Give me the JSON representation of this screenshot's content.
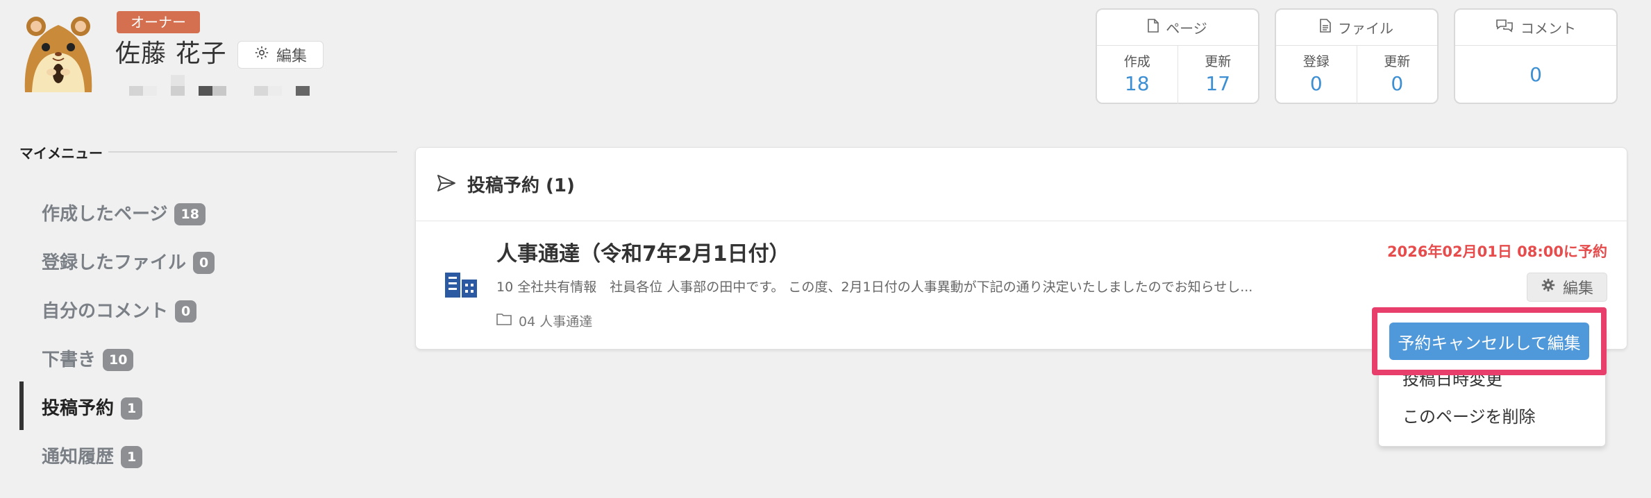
{
  "profile": {
    "role_badge": "オーナー",
    "name": "佐藤 花子",
    "edit_label": "編集"
  },
  "stats": {
    "pages": {
      "title": "ページ",
      "created_label": "作成",
      "created": "18",
      "updated_label": "更新",
      "updated": "17"
    },
    "files": {
      "title": "ファイル",
      "registered_label": "登録",
      "registered": "0",
      "updated_label": "更新",
      "updated": "0"
    },
    "comments": {
      "title": "コメント",
      "count": "0"
    }
  },
  "sidebar": {
    "title": "マイメニュー",
    "items": [
      {
        "label": "作成したページ",
        "count": "18"
      },
      {
        "label": "登録したファイル",
        "count": "0"
      },
      {
        "label": "自分のコメント",
        "count": "0"
      },
      {
        "label": "下書き",
        "count": "10"
      },
      {
        "label": "投稿予約",
        "count": "1"
      },
      {
        "label": "通知履歴",
        "count": "1"
      }
    ]
  },
  "panel": {
    "title": "投稿予約 (1)",
    "article": {
      "title": "人事通達（令和7年2月1日付）",
      "scheduled": "2026年02月01日 08:00に予約",
      "excerpt": "10 全社共有情報　社員各位 人事部の田中です。 この度、2月1日付の人事異動が下記の通り決定いたしましたのでお知らせし...",
      "folder": "04 人事通達",
      "edit_label": "編集"
    }
  },
  "dropdown": {
    "cancel_edit": "予約キャンセルして編集",
    "change_datetime": "投稿日時変更",
    "delete_page": "このページを削除"
  },
  "colors": {
    "accent": "#3d8fd4",
    "danger": "#e74c4c",
    "highlight": "#e83e6c",
    "owner_badge": "#d4704f"
  }
}
